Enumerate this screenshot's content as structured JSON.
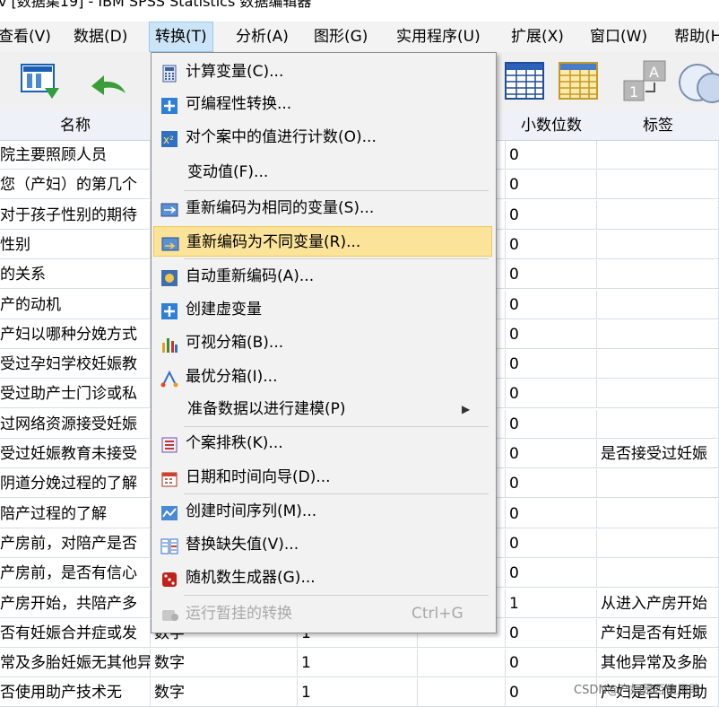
{
  "window": {
    "title": "v [数据集19] - IBM SPSS Statistics 数据编辑器"
  },
  "menubar": {
    "items": [
      "查看(V)",
      "数据(D)",
      "转换(T)",
      "分析(A)",
      "图形(G)",
      "实用程序(U)",
      "扩展(X)",
      "窗口(W)",
      "帮助(H)"
    ],
    "open_item": "转换(T)"
  },
  "grid": {
    "columns": [
      "名称",
      "小数位数",
      "标签"
    ],
    "rows": [
      {
        "name": "院主要照顾人员",
        "type": "",
        "width": "",
        "decimals": "0",
        "label": ""
      },
      {
        "name": "您（产妇）的第几个",
        "type": "",
        "width": "",
        "decimals": "0",
        "label": ""
      },
      {
        "name": "对于孩子性别的期待",
        "type": "",
        "width": "",
        "decimals": "0",
        "label": ""
      },
      {
        "name": "性别",
        "type": "",
        "width": "",
        "decimals": "0",
        "label": ""
      },
      {
        "name": "的关系",
        "type": "",
        "width": "",
        "decimals": "0",
        "label": ""
      },
      {
        "name": "产的动机",
        "type": "",
        "width": "",
        "decimals": "0",
        "label": ""
      },
      {
        "name": "产妇以哪种分娩方式",
        "type": "",
        "width": "",
        "decimals": "0",
        "label": ""
      },
      {
        "name": "受过孕妇学校妊娠教",
        "type": "",
        "width": "",
        "decimals": "0",
        "label": ""
      },
      {
        "name": "受过助产士门诊或私",
        "type": "",
        "width": "",
        "decimals": "0",
        "label": ""
      },
      {
        "name": "过网络资源接受妊娠",
        "type": "",
        "width": "",
        "decimals": "0",
        "label": ""
      },
      {
        "name": "受过妊娠教育未接受",
        "type": "",
        "width": "",
        "decimals": "0",
        "label": "是否接受过妊娠"
      },
      {
        "name": "阴道分娩过程的了解",
        "type": "",
        "width": "",
        "decimals": "0",
        "label": ""
      },
      {
        "name": "陪产过程的了解",
        "type": "",
        "width": "",
        "decimals": "0",
        "label": ""
      },
      {
        "name": "产房前，对陪产是否",
        "type": "",
        "width": "",
        "decimals": "0",
        "label": ""
      },
      {
        "name": "产房前，是否有信心",
        "type": "",
        "width": "",
        "decimals": "0",
        "label": ""
      },
      {
        "name": "产房开始，共陪产多",
        "type": "",
        "width": "",
        "decimals": "1",
        "label": "从进入产房开始"
      },
      {
        "name": "否有妊娠合并症或发",
        "type": "数字",
        "width": "1",
        "decimals": "0",
        "label": "产妇是否有妊娠"
      },
      {
        "name": "常及多胎妊娠无其他异常",
        "type": "数字",
        "width": "1",
        "decimals": "0",
        "label": "其他异常及多胎"
      },
      {
        "name": "否使用助产技术无",
        "type": "数字",
        "width": "1",
        "decimals": "0",
        "label": "产妇是否使用助"
      }
    ]
  },
  "menu": {
    "items": [
      {
        "label": "计算变量(C)...",
        "icon": "calculator-icon",
        "enabled": true
      },
      {
        "label": "可编程性转换...",
        "icon": "plus-square-icon",
        "enabled": true
      },
      {
        "label": "对个案中的值进行计数(O)...",
        "icon": "count-values-icon",
        "enabled": true
      },
      {
        "label": "变动值(F)...",
        "icon": "",
        "enabled": true
      },
      {
        "label": "重新编码为相同的变量(S)...",
        "icon": "recode-same-icon",
        "enabled": true
      },
      {
        "label": "重新编码为不同变量(R)...",
        "icon": "recode-different-icon",
        "enabled": true,
        "highlighted": true
      },
      {
        "label": "自动重新编码(A)...",
        "icon": "auto-recode-icon",
        "enabled": true
      },
      {
        "label": "创建虚变量",
        "icon": "plus-square-icon",
        "enabled": true
      },
      {
        "label": "可视分箱(B)...",
        "icon": "visual-binning-icon",
        "enabled": true
      },
      {
        "label": "最优分箱(I)...",
        "icon": "optimal-binning-icon",
        "enabled": true
      },
      {
        "label": "准备数据以进行建模(P)",
        "icon": "",
        "enabled": true,
        "submenu": true
      },
      {
        "label": "个案排秩(K)...",
        "icon": "rank-cases-icon",
        "enabled": true
      },
      {
        "label": "日期和时间向导(D)...",
        "icon": "calendar-icon",
        "enabled": true
      },
      {
        "label": "创建时间序列(M)...",
        "icon": "time-series-icon",
        "enabled": true
      },
      {
        "label": "替换缺失值(V)...",
        "icon": "replace-missing-icon",
        "enabled": true
      },
      {
        "label": "随机数生成器(G)...",
        "icon": "dice-icon",
        "enabled": true
      },
      {
        "label": "运行暂挂的转换",
        "icon": "run-pending-icon",
        "enabled": false,
        "shortcut": "Ctrl+G"
      }
    ]
  },
  "watermark": "CSDN@产妇是否使用助"
}
